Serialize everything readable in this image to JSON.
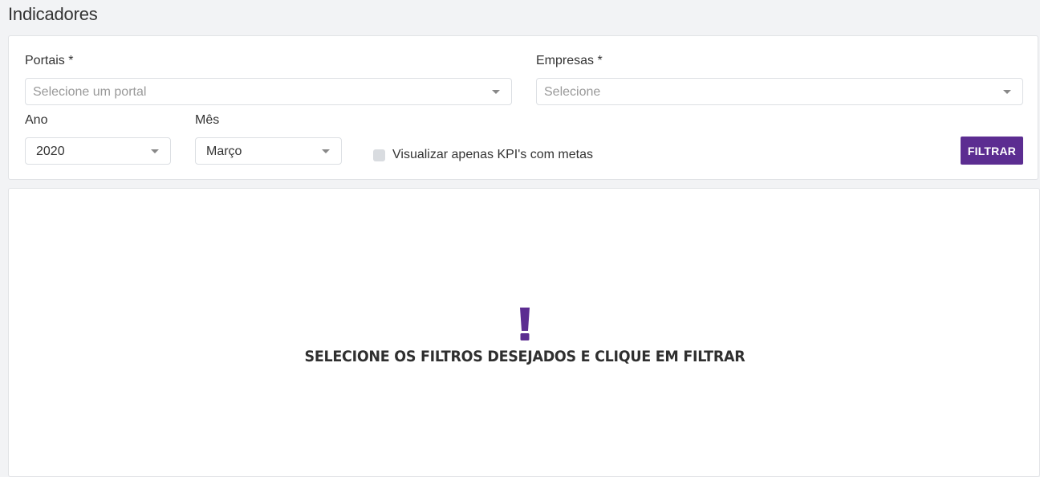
{
  "page": {
    "title": "Indicadores"
  },
  "filters": {
    "portals": {
      "label": "Portais *",
      "placeholder": "Selecione um portal"
    },
    "companies": {
      "label": "Empresas *",
      "placeholder": "Selecione"
    },
    "year": {
      "label": "Ano",
      "value": "2020"
    },
    "month": {
      "label": "Mês",
      "value": "Março"
    },
    "kpi_checkbox": {
      "label": "Visualizar apenas KPI's com metas",
      "checked": false
    },
    "filter_button_label": "FILTRAR"
  },
  "results": {
    "empty_icon": "exclamation-icon",
    "empty_message": "SELECIONE OS FILTROS DESEJADOS E CLIQUE EM FILTRAR"
  },
  "colors": {
    "accent": "#5c2d91",
    "background": "#f2f3f5",
    "card": "#ffffff"
  }
}
